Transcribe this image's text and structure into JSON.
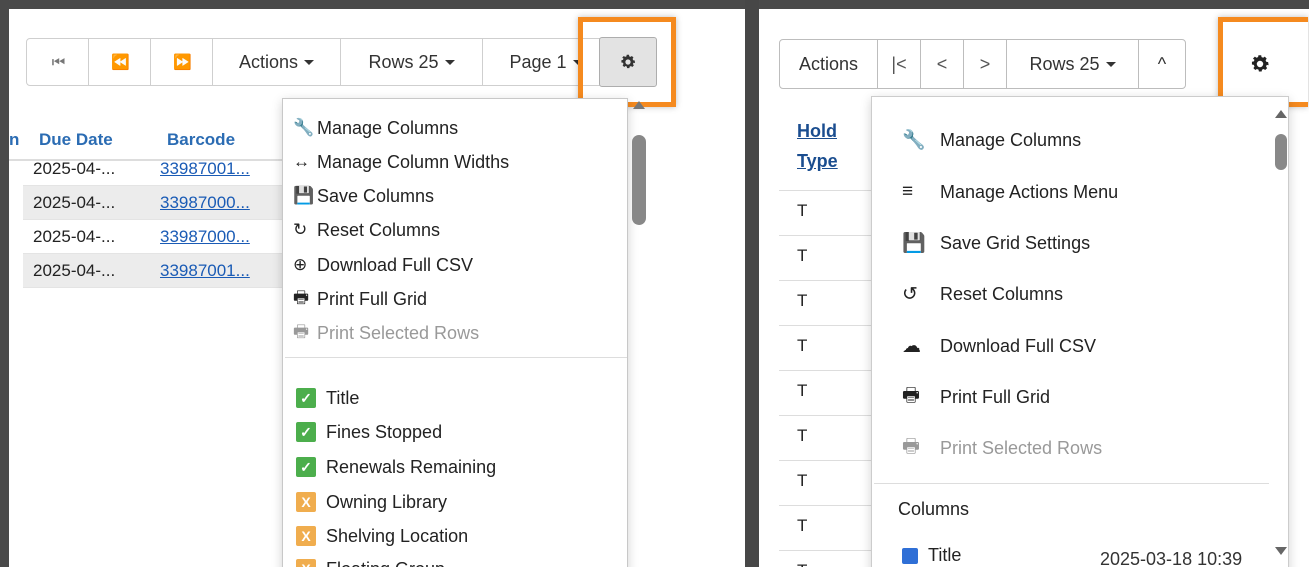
{
  "left": {
    "toolbar": {
      "first_icon": "⏮",
      "prev_icon": "⏪",
      "next_icon": "⏩",
      "actions_label": "Actions",
      "rows_label": "Rows 25",
      "page_label": "Page 1",
      "gear_icon": "gear-icon"
    },
    "grid": {
      "headers": [
        "n",
        "Due Date",
        "Barcode"
      ],
      "rows": [
        {
          "due": "2025-04-...",
          "barcode": "33987001..."
        },
        {
          "due": "2025-04-...",
          "barcode": "33987000..."
        },
        {
          "due": "2025-04-...",
          "barcode": "33987000..."
        },
        {
          "due": "2025-04-...",
          "barcode": "33987001..."
        }
      ]
    },
    "menu": {
      "items": [
        {
          "icon": "🔧",
          "label": "Manage Columns"
        },
        {
          "icon": "↔",
          "label": "Manage Column Widths"
        },
        {
          "icon": "💾",
          "label": "Save Columns"
        },
        {
          "icon": "↻",
          "label": "Reset Columns"
        },
        {
          "icon": "⊕",
          "label": "Download Full CSV"
        },
        {
          "icon": "🖶",
          "label": "Print Full Grid"
        },
        {
          "icon": "🖶",
          "label": "Print Selected Rows"
        }
      ],
      "columns": [
        {
          "mark": "✓",
          "label": "Title"
        },
        {
          "mark": "✓",
          "label": "Fines Stopped"
        },
        {
          "mark": "✓",
          "label": "Renewals Remaining"
        },
        {
          "mark": "X",
          "label": "Owning Library"
        },
        {
          "mark": "X",
          "label": "Shelving Location"
        },
        {
          "mark": "X",
          "label": "Floating Group"
        }
      ]
    }
  },
  "right": {
    "toolbar": {
      "actions_label": "Actions",
      "first_icon": "|<",
      "prev_icon": "<",
      "next_icon": ">",
      "rows_label": "Rows 25",
      "collapse_icon": "^"
    },
    "grid": {
      "header": "Hold Type",
      "header_line1": "Hold",
      "header_line2": "Type",
      "rows": [
        "T",
        "T",
        "T",
        "T",
        "T",
        "T",
        "T",
        "T",
        "T"
      ],
      "partial_date": "2025-03-18 10:39"
    },
    "menu": {
      "items": [
        {
          "icon": "🔧",
          "label": "Manage Columns"
        },
        {
          "icon": "≡",
          "label": "Manage Actions Menu"
        },
        {
          "icon": "💾",
          "label": "Save Grid Settings"
        },
        {
          "icon": "↺",
          "label": "Reset Columns"
        },
        {
          "icon": "☁",
          "label": "Download Full CSV"
        },
        {
          "icon": "🖶",
          "label": "Print Full Grid"
        },
        {
          "icon": "🖶",
          "label": "Print Selected Rows"
        }
      ],
      "columns_heading": "Columns",
      "first_column": "Title"
    }
  },
  "colors": {
    "highlight": "#f58a1f",
    "checked": "#4cae4c",
    "unchecked": "#f0ad4e",
    "link": "#1a5bb5"
  }
}
